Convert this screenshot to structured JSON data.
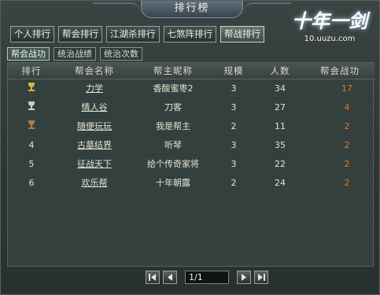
{
  "window": {
    "title": "排行榜"
  },
  "logo": {
    "title": "十年一剑",
    "url": "10.uuzu.com"
  },
  "tabs": [
    {
      "label": "个人排行",
      "active": false
    },
    {
      "label": "帮会排行",
      "active": false
    },
    {
      "label": "江湖杀排行",
      "active": false
    },
    {
      "label": "七煞阵排行",
      "active": false
    },
    {
      "label": "帮战排行",
      "active": true
    }
  ],
  "subtabs": [
    {
      "label": "帮会战功",
      "active": true
    },
    {
      "label": "统治战绩",
      "active": false
    },
    {
      "label": "统治次数",
      "active": false
    }
  ],
  "table": {
    "headers": {
      "rank": "排行",
      "guild": "帮会名称",
      "leader": "帮主昵称",
      "scale": "规模",
      "members": "人数",
      "power": "帮会战功"
    },
    "rows": [
      {
        "rank": "",
        "rank_icon": "gold-trophy-icon",
        "guild": "力学",
        "leader": "香酸蜜枣2",
        "scale": "3",
        "members": "34",
        "power": "17"
      },
      {
        "rank": "",
        "rank_icon": "silver-trophy-icon",
        "guild": "情人谷",
        "leader": "刀客",
        "scale": "3",
        "members": "27",
        "power": "4"
      },
      {
        "rank": "",
        "rank_icon": "bronze-trophy-icon",
        "guild": "随便玩玩",
        "leader": "我是帮主",
        "scale": "2",
        "members": "11",
        "power": "2"
      },
      {
        "rank": "4",
        "rank_icon": "",
        "guild": "古墓结界",
        "leader": "听琴",
        "scale": "3",
        "members": "35",
        "power": "2"
      },
      {
        "rank": "5",
        "rank_icon": "",
        "guild": "征战天下",
        "leader": "给个传奇家将",
        "scale": "3",
        "members": "22",
        "power": "2"
      },
      {
        "rank": "6",
        "rank_icon": "",
        "guild": "欢乐帮",
        "leader": "十年朝露",
        "scale": "2",
        "members": "24",
        "power": "2"
      }
    ]
  },
  "pager": {
    "value": "1/1"
  },
  "colors": {
    "power_text": "#e8761e",
    "trophy_gold": "#d8b24a",
    "trophy_silver": "#c8ccd0",
    "trophy_bronze": "#b07a3e"
  }
}
